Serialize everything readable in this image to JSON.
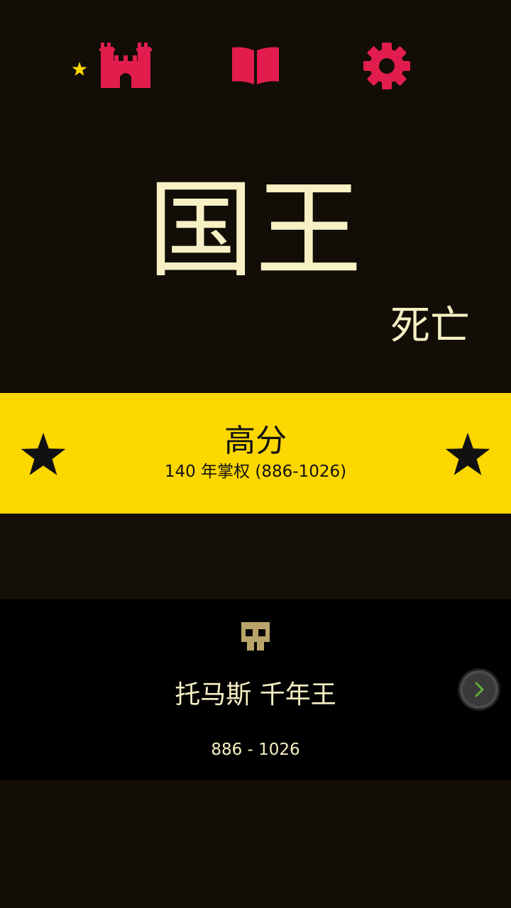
{
  "topbar": {
    "buttons": [
      {
        "icon": "castle-icon",
        "badge_icon": "star-icon",
        "color": "#e21d4d",
        "badge_color": "#fdd700"
      },
      {
        "icon": "book-icon",
        "color": "#e21d4d"
      },
      {
        "icon": "gear-icon",
        "color": "#e21d4d"
      }
    ]
  },
  "header": {
    "title": "国王",
    "subtitle": "死亡"
  },
  "highscore": {
    "title": "高分",
    "detail": "140 年掌权 (886-1026)",
    "background": "#fdd700",
    "star_icon": "star-icon"
  },
  "king": {
    "icon": "skull-icon",
    "name": "托马斯 千年王",
    "years": "886 - 1026",
    "next_icon": "chevron-right-icon"
  },
  "colors": {
    "background": "#120d07",
    "accent": "#e21d4d",
    "text": "#f6f0c4",
    "highscore_bg": "#fdd700",
    "skull": "#b9a56b",
    "chevron": "#5fae3a"
  }
}
